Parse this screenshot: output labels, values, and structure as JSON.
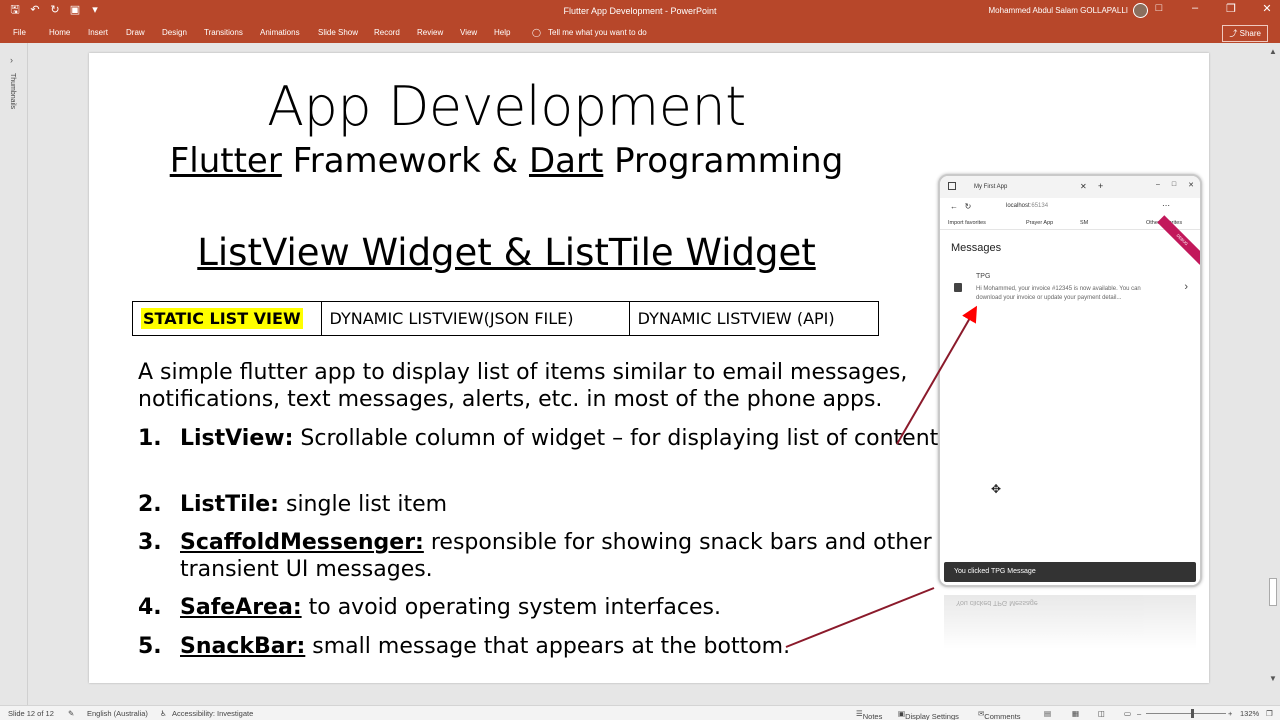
{
  "window": {
    "title": "Flutter App Development  -  PowerPoint",
    "user": "Mohammed Abdul Salam GOLLAPALLI"
  },
  "ribbon": {
    "tabs": [
      "File",
      "Home",
      "Insert",
      "Draw",
      "Design",
      "Transitions",
      "Animations",
      "Slide Show",
      "Record",
      "Review",
      "View",
      "Help"
    ],
    "tell_me": "Tell me what you want to do",
    "share": "Share"
  },
  "thumbnails_pane": {
    "label": "Thumbnails"
  },
  "slide": {
    "title": "App Development",
    "subtitle_parts": [
      "Flutter",
      " Framework & ",
      "Dart",
      " Programming"
    ],
    "heading": "ListView Widget & ListTile Widget",
    "table_cells": [
      "STATIC LIST VIEW",
      "DYNAMIC LISTVIEW(JSON FILE)",
      "DYNAMIC LISTVIEW (API)"
    ],
    "intro": "A simple flutter app to display list of items similar to email messages, notifications, text messages, alerts, etc. in most of the phone apps.",
    "items": [
      {
        "num": "1.",
        "term": "ListView:",
        "text": " Scrollable column of widget – for displaying list of content"
      },
      {
        "num": "2.",
        "term": "ListTile:",
        "text": " single list item"
      },
      {
        "num": "3.",
        "term": "ScaffoldMessenger:",
        "text": " responsible for showing snack bars and other transient UI messages."
      },
      {
        "num": "4.",
        "term": "SafeArea:",
        "text": " to avoid operating system interfaces."
      },
      {
        "num": "5.",
        "term": "SnackBar:",
        "text": " small message that appears at the bottom."
      }
    ]
  },
  "browser": {
    "tab_title": "My First App",
    "url_host": "localhost",
    "url_port": ":65134",
    "favorites": [
      "Import favorites",
      "Prayer App",
      "SM",
      "Other favorites"
    ],
    "app_title": "Messages",
    "debug_banner": "DEBUG",
    "tile_title": "TPG",
    "tile_subtitle": "Hi Mohammed, your invoice #12345 is now available. You can download your invoice or update your payment detail...",
    "snackbar": "You clicked TPG Message"
  },
  "statusbar": {
    "slide_info": "Slide 12 of 12",
    "language": "English (Australia)",
    "accessibility": "Accessibility: Investigate",
    "notes": "Notes",
    "display_settings": "Display Settings",
    "comments": "Comments",
    "zoom": "132%"
  },
  "colors": {
    "ribbon": "#b7472a",
    "highlight": "#ffff00",
    "arrow": "#8b1a2b"
  }
}
